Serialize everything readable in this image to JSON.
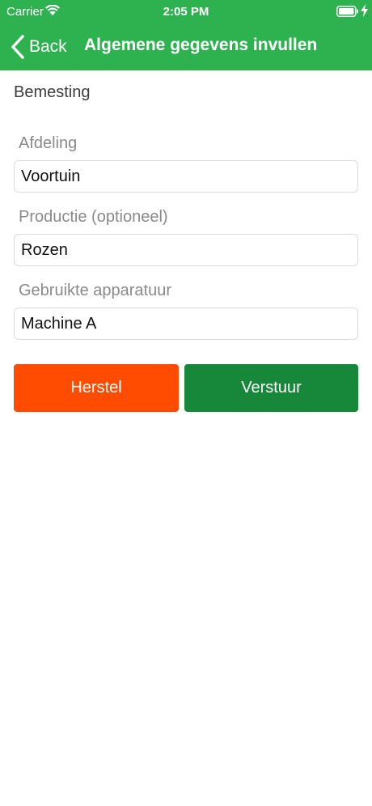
{
  "status_bar": {
    "carrier": "Carrier",
    "time": "2:05 PM"
  },
  "nav": {
    "back_label": "Back",
    "title": "Algemene gegevens invullen"
  },
  "form": {
    "section_title": "Bemesting",
    "fields": [
      {
        "label": "Afdeling",
        "value": "Voortuin"
      },
      {
        "label": "Productie (optioneel)",
        "value": "Rozen"
      },
      {
        "label": "Gebruikte apparatuur",
        "value": "Machine A"
      }
    ]
  },
  "buttons": {
    "reset_label": "Herstel",
    "send_label": "Verstuur"
  },
  "colors": {
    "header_green": "#2eb250",
    "reset_orange": "#ff4c00",
    "send_green": "#17883a"
  }
}
